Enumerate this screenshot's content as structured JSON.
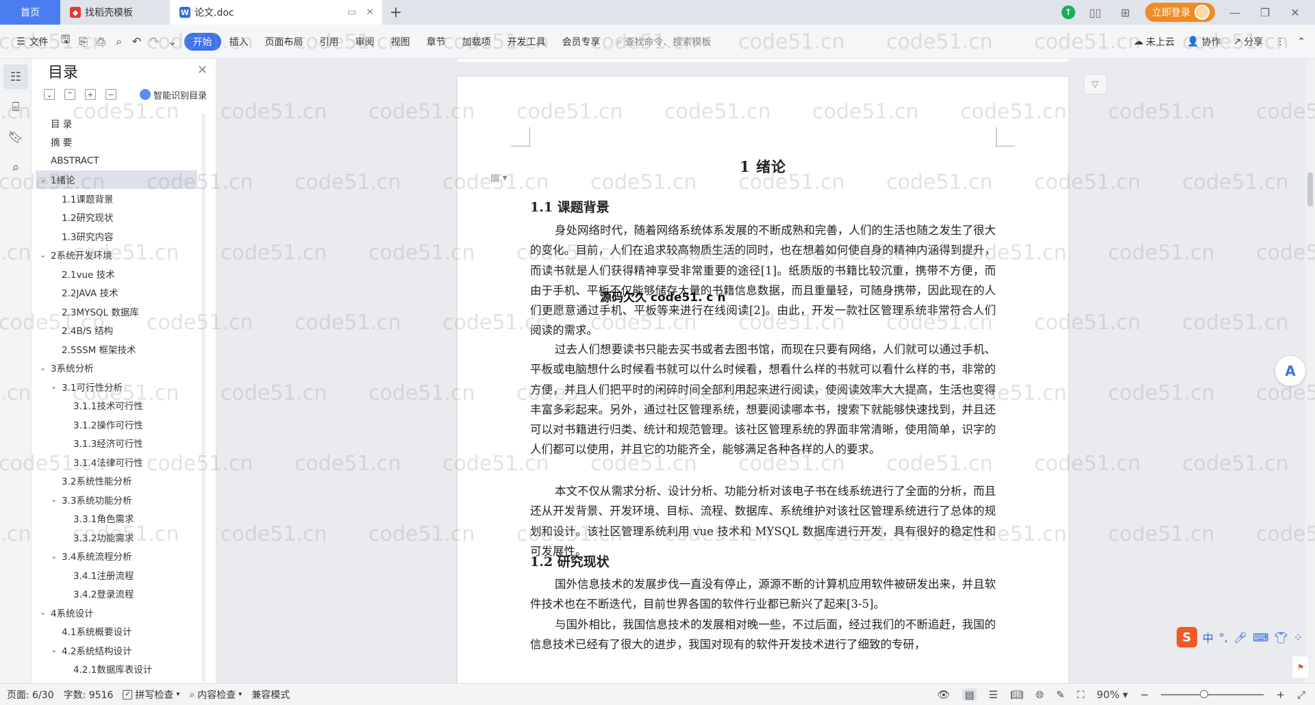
{
  "tabs": {
    "home": "首页",
    "template": "找稻壳模板",
    "document": "论文.doc"
  },
  "titlebar": {
    "login": "立即登录"
  },
  "ribbon": {
    "file": "文件",
    "menus": [
      "开始",
      "插入",
      "页面布局",
      "引用",
      "审阅",
      "视图",
      "章节",
      "加载项",
      "开发工具",
      "会员专享"
    ],
    "active_menu": "开始",
    "search": "查找命令、搜索模板",
    "cloud": "未上云",
    "collab": "协作",
    "share": "分享"
  },
  "toc": {
    "title": "目录",
    "smart": "智能识别目录",
    "items": [
      {
        "text": "目  录",
        "level": 1,
        "arrow": ""
      },
      {
        "text": "摘    要",
        "level": 1,
        "arrow": ""
      },
      {
        "text": "ABSTRACT",
        "level": 1,
        "arrow": ""
      },
      {
        "text": "1绪论",
        "level": 1,
        "arrow": "v",
        "selected": true
      },
      {
        "text": "1.1课题背景",
        "level": 2,
        "arrow": ""
      },
      {
        "text": "1.2研究现状",
        "level": 2,
        "arrow": ""
      },
      {
        "text": "1.3研究内容",
        "level": 2,
        "arrow": ""
      },
      {
        "text": "2系统开发环境",
        "level": 1,
        "arrow": "v"
      },
      {
        "text": "2.1vue 技术",
        "level": 2,
        "arrow": ""
      },
      {
        "text": "2.2JAVA 技术",
        "level": 2,
        "arrow": ""
      },
      {
        "text": "2.3MYSQL 数据库",
        "level": 2,
        "arrow": ""
      },
      {
        "text": "2.4B/S 结构",
        "level": 2,
        "arrow": ""
      },
      {
        "text": "2.5SSM 框架技术",
        "level": 2,
        "arrow": ""
      },
      {
        "text": "3系统分析",
        "level": 1,
        "arrow": "v"
      },
      {
        "text": "3.1可行性分析",
        "level": 2,
        "arrow": "v"
      },
      {
        "text": "3.1.1技术可行性",
        "level": 3,
        "arrow": ""
      },
      {
        "text": "3.1.2操作可行性",
        "level": 3,
        "arrow": ""
      },
      {
        "text": "3.1.3经济可行性",
        "level": 3,
        "arrow": ""
      },
      {
        "text": "3.1.4法律可行性",
        "level": 3,
        "arrow": ""
      },
      {
        "text": "3.2系统性能分析",
        "level": 2,
        "arrow": ""
      },
      {
        "text": "3.3系统功能分析",
        "level": 2,
        "arrow": "v"
      },
      {
        "text": "3.3.1角色需求",
        "level": 3,
        "arrow": ""
      },
      {
        "text": "3.3.2功能需求",
        "level": 3,
        "arrow": ""
      },
      {
        "text": "3.4系统流程分析",
        "level": 2,
        "arrow": "v"
      },
      {
        "text": "3.4.1注册流程",
        "level": 3,
        "arrow": ""
      },
      {
        "text": "3.4.2登录流程",
        "level": 3,
        "arrow": ""
      },
      {
        "text": "4系统设计",
        "level": 1,
        "arrow": "v"
      },
      {
        "text": "4.1系统概要设计",
        "level": 2,
        "arrow": ""
      },
      {
        "text": "4.2系统结构设计",
        "level": 2,
        "arrow": "v"
      },
      {
        "text": "4.2.1数据库表设计",
        "level": 3,
        "arrow": ""
      }
    ]
  },
  "document": {
    "chapter_title": "1  绪论",
    "h_background": "1.1  课题背景",
    "p1": "身处网络时代，随着网络系统体系发展的不断成熟和完善，人们的生活也随之发生了很大的变化。目前，人们在追求较高物质生活的同时，也在想着如何使自身的精神内涵得到提升，而读书就是人们获得精神享受非常重要的途径[1]。纸质版的书籍比较沉重，携带不方便，而由于手机、平板不仅能够储存大量的书籍信息数据，而且重量轻，可随身携带，因此现在的人们更愿意通过手机、平板等来进行在线阅读[2]。由此，开发一款社区管理系统非常符合人们阅读的需求。",
    "p2": "过去人们想要读书只能去买书或者去图书馆，而现在只要有网络，人们就可以通过手机、平板或电脑想什么时候看书就可以什么时候看，想看什么样的书就可以看什么样的书，非常的方便，并且人们把平时的闲碎时间全部利用起来进行阅读，使阅读效率大大提高，生活也变得丰富多彩起来。另外，通过社区管理系统，想要阅读哪本书，搜索下就能够快速找到，并且还可以对书籍进行归类、统计和规范管理。该社区管理系统的界面非常清晰，使用简单，识字的人们都可以使用，并且它的功能齐全，能够满足各种各样的人的要求。",
    "p3": "本文不仅从需求分析、设计分析、功能分析对该电子书在线系统进行了全面的分析，而且还从开发背景、开发环境、目标、流程、数据库、系统维护对该社区管理系统进行了总体的规划和设计。该社区管理系统利用 vue 技术和 MYSQL 数据库进行开发，具有很好的稳定性和可发展性。",
    "h_status": "1.2  研究现状",
    "p4": "国外信息技术的发展步伐一直没有停止，源源不断的计算机应用软件被研发出来，并且软件技术也在不断迭代，目前世界各国的软件行业都已新兴了起来[3-5]。",
    "p5": "与国外相比，我国信息技术的发展相对晚一些，不过后面，经过我们的不断追赶，我国的信息技术已经有了很大的进步，我国对现有的软件开发技术进行了细致的专研，",
    "popup_text": "源码欠久 code51. c n"
  },
  "watermark": "code51.cn",
  "statusbar": {
    "page": "页面: 6/30",
    "words": "字数: 9516",
    "spell": "拼写检查",
    "content_check": "内容检查",
    "compat": "兼容模式",
    "zoom": "90%",
    "zoom_level": 0.42
  },
  "ime": {
    "lang": "中"
  }
}
